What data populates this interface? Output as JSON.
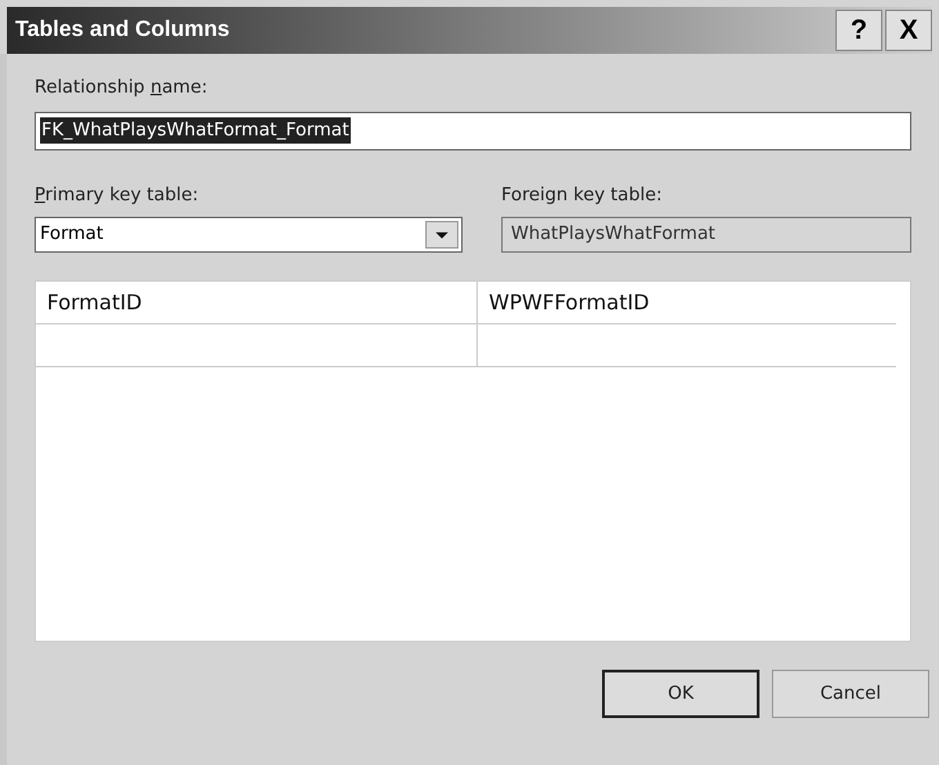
{
  "window": {
    "title": "Tables and Columns",
    "title_buttons": [
      "?",
      "X"
    ]
  },
  "relationship": {
    "label": {
      "before": "Relationship ",
      "key": "n",
      "after": "ame:"
    },
    "value": "FK_WhatPlaysWhatFormat_Format",
    "selected": true
  },
  "primary": {
    "label": {
      "key": "P",
      "after": "rimary key table:"
    },
    "value": "Format"
  },
  "foreign": {
    "label": {
      "before": "Foreign key table:"
    },
    "value": "WhatPlaysWhatFormat",
    "disabled": true
  },
  "table": {
    "rows": [
      {
        "cells": [
          "FormatID",
          "WPWFFormatID"
        ]
      }
    ]
  },
  "buttons": [
    {
      "label": "OK",
      "default": true
    },
    {
      "label": "Cancel",
      "default": false
    }
  ]
}
